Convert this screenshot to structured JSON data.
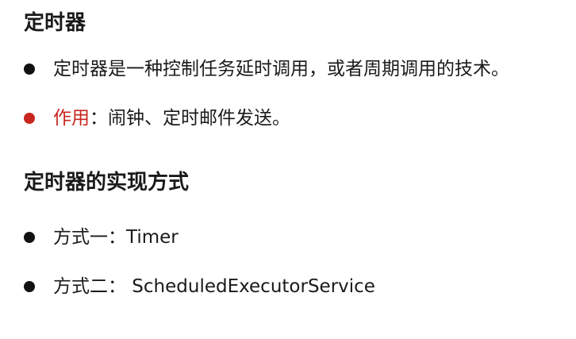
{
  "section1": {
    "title": "定时器",
    "bullets": [
      {
        "text": "定时器是一种控制任务延时调用，或者周期调用的技术。"
      },
      {
        "label": "作用",
        "text": "：闹钟、定时邮件发送。"
      }
    ]
  },
  "section2": {
    "title": "定时器的实现方式",
    "bullets": [
      {
        "text": "方式一：Timer"
      },
      {
        "text": "方式二： ScheduledExecutorService"
      }
    ]
  },
  "colors": {
    "accent": "#c8261e",
    "text": "#1a1a1a",
    "bullet": "#111111"
  }
}
